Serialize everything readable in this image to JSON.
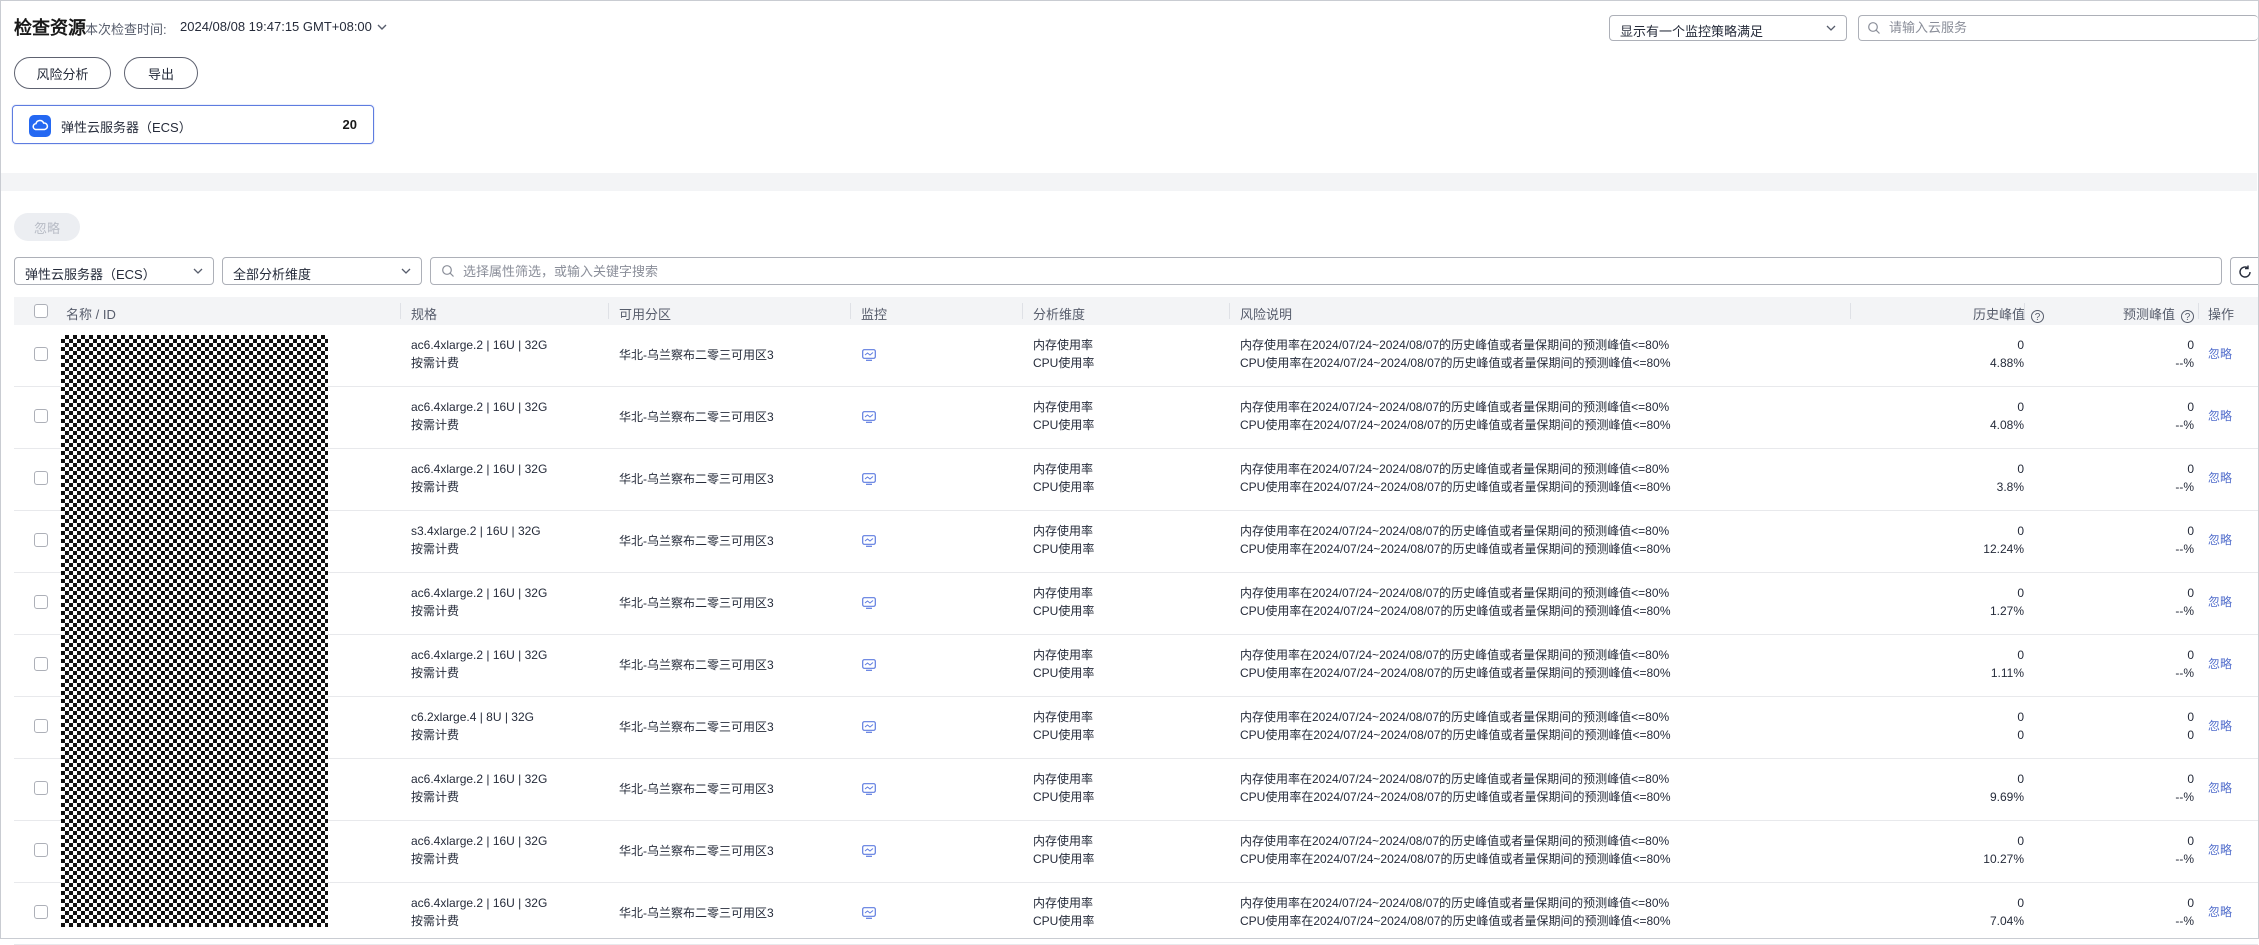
{
  "header": {
    "title": "检查资源",
    "check_time_label": "本次检查时间:",
    "check_time_value": "2024/08/08 19:47:15 GMT+08:00",
    "policy_select": "显示有一个监控策略满足",
    "service_search_placeholder": "请输入云服务"
  },
  "actions": {
    "risk_analysis": "风险分析",
    "export": "导出",
    "ignore_all": "忽略"
  },
  "service_card": {
    "name": "弹性云服务器（ECS）",
    "count": "20",
    "icon": "cloud-icon",
    "icon_color": "#2468f2"
  },
  "filters": {
    "service": "弹性云服务器（ECS）",
    "dimension": "全部分析维度",
    "search_placeholder": "选择属性筛选，或输入关键字搜索"
  },
  "table": {
    "columns": {
      "name": "名称 / ID",
      "spec": "规格",
      "zone": "可用分区",
      "monitor": "监控",
      "dimension": "分析维度",
      "risk": "风险说明",
      "history_peak": "历史峰值",
      "predict_peak": "预测峰值",
      "operation": "操作"
    },
    "rows": [
      {
        "spec": "ac6.4xlarge.2 | 16U | 32G",
        "billing": "按需计费",
        "zone": "华北-乌兰察布二零三可用区3",
        "dim1": "内存使用率",
        "dim2": "CPU使用率",
        "risk1": "内存使用率在2024/07/24~2024/08/07的历史峰值或者量保期间的预测峰值<=80%",
        "risk2": "CPU使用率在2024/07/24~2024/08/07的历史峰值或者量保期间的预测峰值<=80%",
        "hist1": "0",
        "hist2": "4.88%",
        "pred1": "0",
        "pred2": "--%",
        "op": "忽略"
      },
      {
        "spec": "ac6.4xlarge.2 | 16U | 32G",
        "billing": "按需计费",
        "zone": "华北-乌兰察布二零三可用区3",
        "dim1": "内存使用率",
        "dim2": "CPU使用率",
        "risk1": "内存使用率在2024/07/24~2024/08/07的历史峰值或者量保期间的预测峰值<=80%",
        "risk2": "CPU使用率在2024/07/24~2024/08/07的历史峰值或者量保期间的预测峰值<=80%",
        "hist1": "0",
        "hist2": "4.08%",
        "pred1": "0",
        "pred2": "--%",
        "op": "忽略"
      },
      {
        "spec": "ac6.4xlarge.2 | 16U | 32G",
        "billing": "按需计费",
        "zone": "华北-乌兰察布二零三可用区3",
        "dim1": "内存使用率",
        "dim2": "CPU使用率",
        "risk1": "内存使用率在2024/07/24~2024/08/07的历史峰值或者量保期间的预测峰值<=80%",
        "risk2": "CPU使用率在2024/07/24~2024/08/07的历史峰值或者量保期间的预测峰值<=80%",
        "hist1": "0",
        "hist2": "3.8%",
        "pred1": "0",
        "pred2": "--%",
        "op": "忽略"
      },
      {
        "spec": "s3.4xlarge.2 | 16U | 32G",
        "billing": "按需计费",
        "zone": "华北-乌兰察布二零三可用区3",
        "dim1": "内存使用率",
        "dim2": "CPU使用率",
        "risk1": "内存使用率在2024/07/24~2024/08/07的历史峰值或者量保期间的预测峰值<=80%",
        "risk2": "CPU使用率在2024/07/24~2024/08/07的历史峰值或者量保期间的预测峰值<=80%",
        "hist1": "0",
        "hist2": "12.24%",
        "pred1": "0",
        "pred2": "--%",
        "op": "忽略"
      },
      {
        "spec": "ac6.4xlarge.2 | 16U | 32G",
        "billing": "按需计费",
        "zone": "华北-乌兰察布二零三可用区3",
        "dim1": "内存使用率",
        "dim2": "CPU使用率",
        "risk1": "内存使用率在2024/07/24~2024/08/07的历史峰值或者量保期间的预测峰值<=80%",
        "risk2": "CPU使用率在2024/07/24~2024/08/07的历史峰值或者量保期间的预测峰值<=80%",
        "hist1": "0",
        "hist2": "1.27%",
        "pred1": "0",
        "pred2": "--%",
        "op": "忽略"
      },
      {
        "spec": "ac6.4xlarge.2 | 16U | 32G",
        "billing": "按需计费",
        "zone": "华北-乌兰察布二零三可用区3",
        "dim1": "内存使用率",
        "dim2": "CPU使用率",
        "risk1": "内存使用率在2024/07/24~2024/08/07的历史峰值或者量保期间的预测峰值<=80%",
        "risk2": "CPU使用率在2024/07/24~2024/08/07的历史峰值或者量保期间的预测峰值<=80%",
        "hist1": "0",
        "hist2": "1.11%",
        "pred1": "0",
        "pred2": "--%",
        "op": "忽略"
      },
      {
        "spec": "c6.2xlarge.4 | 8U | 32G",
        "billing": "按需计费",
        "zone": "华北-乌兰察布二零三可用区3",
        "dim1": "内存使用率",
        "dim2": "CPU使用率",
        "risk1": "内存使用率在2024/07/24~2024/08/07的历史峰值或者量保期间的预测峰值<=80%",
        "risk2": "CPU使用率在2024/07/24~2024/08/07的历史峰值或者量保期间的预测峰值<=80%",
        "hist1": "0",
        "hist2": "0",
        "pred1": "0",
        "pred2": "0",
        "op": "忽略"
      },
      {
        "spec": "ac6.4xlarge.2 | 16U | 32G",
        "billing": "按需计费",
        "zone": "华北-乌兰察布二零三可用区3",
        "dim1": "内存使用率",
        "dim2": "CPU使用率",
        "risk1": "内存使用率在2024/07/24~2024/08/07的历史峰值或者量保期间的预测峰值<=80%",
        "risk2": "CPU使用率在2024/07/24~2024/08/07的历史峰值或者量保期间的预测峰值<=80%",
        "hist1": "0",
        "hist2": "9.69%",
        "pred1": "0",
        "pred2": "--%",
        "op": "忽略"
      },
      {
        "spec": "ac6.4xlarge.2 | 16U | 32G",
        "billing": "按需计费",
        "zone": "华北-乌兰察布二零三可用区3",
        "dim1": "内存使用率",
        "dim2": "CPU使用率",
        "risk1": "内存使用率在2024/07/24~2024/08/07的历史峰值或者量保期间的预测峰值<=80%",
        "risk2": "CPU使用率在2024/07/24~2024/08/07的历史峰值或者量保期间的预测峰值<=80%",
        "hist1": "0",
        "hist2": "10.27%",
        "pred1": "0",
        "pred2": "--%",
        "op": "忽略"
      },
      {
        "spec": "ac6.4xlarge.2 | 16U | 32G",
        "billing": "按需计费",
        "zone": "华北-乌兰察布二零三可用区3",
        "dim1": "内存使用率",
        "dim2": "CPU使用率",
        "risk1": "内存使用率在2024/07/24~2024/08/07的历史峰值或者量保期间的预测峰值<=80%",
        "risk2": "CPU使用率在2024/07/24~2024/08/07的历史峰值或者量保期间的预测峰值<=80%",
        "hist1": "0",
        "hist2": "7.04%",
        "pred1": "0",
        "pred2": "--%",
        "op": "忽略"
      }
    ]
  },
  "colors": {
    "accent": "#5e7ce0",
    "link": "#526ecc",
    "header_bg": "#f3f4f6"
  }
}
